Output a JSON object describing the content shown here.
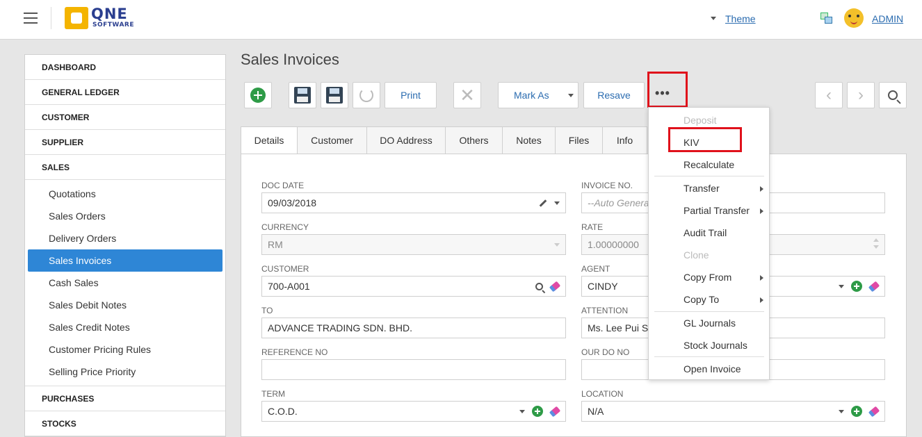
{
  "header": {
    "logo_text": "QNE",
    "logo_sub": "SOFTWARE",
    "theme_label": "Theme",
    "user_label": "ADMIN"
  },
  "sidebar": {
    "groups": {
      "dashboard": "DASHBOARD",
      "general_ledger": "GENERAL LEDGER",
      "customer": "CUSTOMER",
      "supplier": "SUPPLIER",
      "sales": "SALES",
      "purchases": "PURCHASES",
      "stocks": "STOCKS"
    },
    "sales_items": [
      "Quotations",
      "Sales Orders",
      "Delivery Orders",
      "Sales Invoices",
      "Cash Sales",
      "Sales Debit Notes",
      "Sales Credit Notes",
      "Customer Pricing Rules",
      "Selling Price Priority"
    ],
    "active_item": "Sales Invoices"
  },
  "page": {
    "title": "Sales Invoices"
  },
  "toolbar": {
    "print_label": "Print",
    "mark_as_label": "Mark As",
    "resave_label": "Resave",
    "more_label": "•••"
  },
  "tabs": [
    "Details",
    "Customer",
    "DO Address",
    "Others",
    "Notes",
    "Files",
    "Info"
  ],
  "form": {
    "doc_date": {
      "label": "DOC DATE",
      "value": "09/03/2018"
    },
    "invoice_no": {
      "label": "INVOICE NO.",
      "placeholder": "--Auto Genera"
    },
    "currency": {
      "label": "CURRENCY",
      "value": "RM"
    },
    "rate": {
      "label": "RATE",
      "value": "1.00000000"
    },
    "customer": {
      "label": "CUSTOMER",
      "value": "700-A001"
    },
    "agent": {
      "label": "AGENT",
      "value": "CINDY"
    },
    "to": {
      "label": "TO",
      "value": "ADVANCE TRADING SDN. BHD."
    },
    "attention": {
      "label": "ATTENTION",
      "value": "Ms. Lee Pui Sa"
    },
    "reference_no": {
      "label": "REFERENCE NO",
      "value": ""
    },
    "our_do_no": {
      "label": "OUR DO NO",
      "value": ""
    },
    "term": {
      "label": "TERM",
      "value": "C.O.D."
    },
    "location": {
      "label": "LOCATION",
      "value": "N/A"
    }
  },
  "menu": {
    "items": {
      "deposit": "Deposit",
      "kiv": "KIV",
      "recalculate": "Recalculate",
      "transfer": "Transfer",
      "partial_transfer": "Partial Transfer",
      "audit_trail": "Audit Trail",
      "clone": "Clone",
      "copy_from": "Copy From",
      "copy_to": "Copy To",
      "gl_journals": "GL Journals",
      "stock_journals": "Stock Journals",
      "open_invoice": "Open Invoice"
    }
  },
  "colors": {
    "highlight_red": "#e0111b",
    "active_blue": "#2e86d6",
    "add_green": "#2e9b47",
    "link_blue": "#2b6cb0"
  }
}
